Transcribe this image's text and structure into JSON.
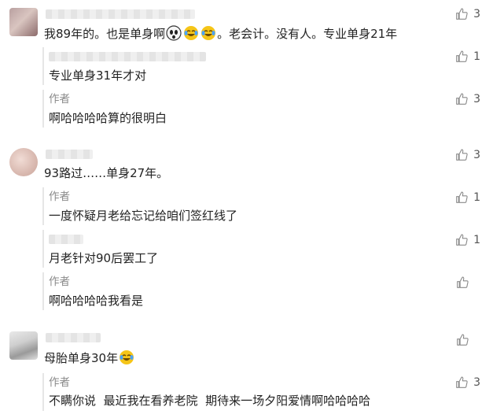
{
  "comments": [
    {
      "text_a": "我89年的。也是单身啊",
      "text_b": "。老会计。没有人。专业单身21年",
      "likes": "3",
      "emoji": [
        "ghost-face-emoji",
        "laughing-tears-emoji",
        "laughing-tears-emoji"
      ]
    },
    {
      "text": "专业单身31年才对",
      "likes": "1"
    },
    {
      "author": "作者",
      "text": "啊哈哈哈哈算的很明白",
      "likes": "3"
    },
    {
      "text": "93路过……单身27年。",
      "likes": "3"
    },
    {
      "author": "作者",
      "text": "一度怀疑月老给忘记给咱们签红线了",
      "likes": "1"
    },
    {
      "text": "月老针对90后罢工了",
      "likes": "1"
    },
    {
      "author": "作者",
      "text": "啊哈哈哈哈我看是",
      "likes": ""
    },
    {
      "text": "母胎单身30年",
      "likes": "",
      "emoji": [
        "laughing-tears-emoji"
      ]
    },
    {
      "author": "作者",
      "text": "不瞒你说  最近我在看养老院  期待来一场夕阳爱情啊哈哈哈哈",
      "likes": "3"
    }
  ],
  "colors": {
    "like_icon": "#8a8a8a",
    "divider": "#e6e6e6",
    "author_label": "#8a8a8a"
  }
}
